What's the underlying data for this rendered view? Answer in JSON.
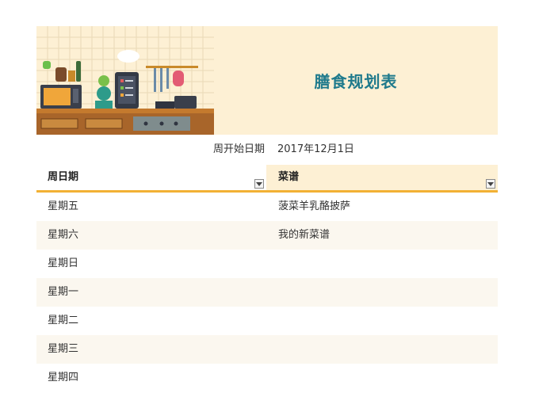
{
  "sheet": {
    "title": "膳食规划表",
    "start_date_label": "周开始日期",
    "start_date_value": "2017年12月1日",
    "columns": {
      "day": "周日期",
      "recipe": "菜谱"
    },
    "rows": [
      {
        "day": "星期五",
        "recipe": "菠菜羊乳酪披萨"
      },
      {
        "day": "星期六",
        "recipe": "我的新菜谱"
      },
      {
        "day": "星期日",
        "recipe": ""
      },
      {
        "day": "星期一",
        "recipe": ""
      },
      {
        "day": "星期二",
        "recipe": ""
      },
      {
        "day": "星期三",
        "recipe": ""
      },
      {
        "day": "星期四",
        "recipe": ""
      }
    ]
  },
  "colors": {
    "title": "#1f7a8c",
    "banner": "#fdf0d4",
    "header_underline": "#f2b134",
    "row_alt": "#fbf7ef"
  }
}
